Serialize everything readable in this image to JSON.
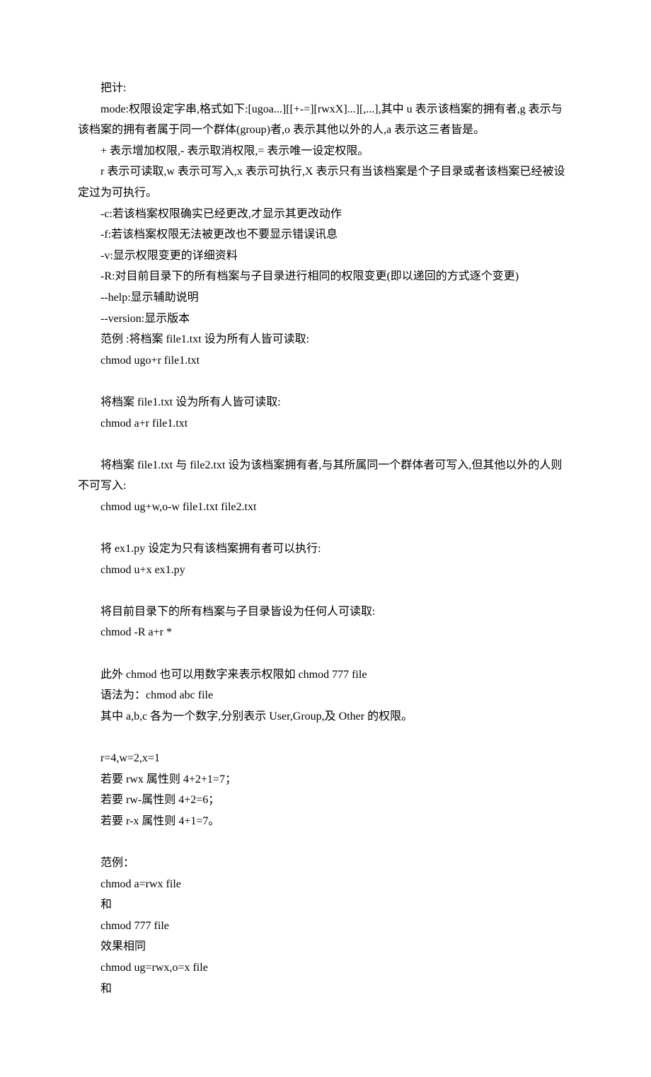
{
  "lines": [
    {
      "indent": true,
      "text": "把计:"
    },
    {
      "indent": true,
      "text": "mode:权限设定字串,格式如下:[ugoa...][[+-=][rwxX]...][,...],其中 u 表示该档案的拥有者,g 表示与该档案的拥有者属于同一个群体(group)者,o 表示其他以外的人,a 表示这三者皆是。",
      "wrap": true
    },
    {
      "indent": true,
      "text": "+ 表示增加权限,- 表示取消权限,= 表示唯一设定权限。"
    },
    {
      "indent": true,
      "text": "r 表示可读取,w 表示可写入,x 表示可执行,X 表示只有当该档案是个子目录或者该档案已经被设定过为可执行。",
      "wrap": true
    },
    {
      "indent": true,
      "text": "-c:若该档案权限确实已经更改,才显示其更改动作"
    },
    {
      "indent": true,
      "text": "-f:若该档案权限无法被更改也不要显示错误讯息"
    },
    {
      "indent": true,
      "text": "-v:显示权限变更的详细资料"
    },
    {
      "indent": true,
      "text": "-R:对目前目录下的所有档案与子目录进行相同的权限变更(即以递回的方式逐个变更)"
    },
    {
      "indent": true,
      "text": "--help:显示辅助说明"
    },
    {
      "indent": true,
      "text": "--version:显示版本"
    },
    {
      "indent": true,
      "text": "范例 :将档案 file1.txt 设为所有人皆可读取:"
    },
    {
      "indent": true,
      "text": "chmod ugo+r file1.txt"
    },
    {
      "blank": true
    },
    {
      "indent": true,
      "text": "将档案 file1.txt 设为所有人皆可读取:"
    },
    {
      "indent": true,
      "text": "chmod a+r file1.txt"
    },
    {
      "blank": true
    },
    {
      "indent": true,
      "text": "将档案 file1.txt 与 file2.txt 设为该档案拥有者,与其所属同一个群体者可写入,但其他以外的人则不可写入:",
      "wrap": true
    },
    {
      "indent": true,
      "text": "chmod ug+w,o-w file1.txt file2.txt"
    },
    {
      "blank": true
    },
    {
      "indent": true,
      "text": "将 ex1.py 设定为只有该档案拥有者可以执行:"
    },
    {
      "indent": true,
      "text": "chmod u+x ex1.py"
    },
    {
      "blank": true
    },
    {
      "indent": true,
      "text": "将目前目录下的所有档案与子目录皆设为任何人可读取:"
    },
    {
      "indent": true,
      "text": "chmod -R a+r *"
    },
    {
      "blank": true
    },
    {
      "indent": true,
      "text": "此外 chmod 也可以用数字来表示权限如 chmod 777 file"
    },
    {
      "indent": true,
      "text": "语法为：chmod abc file"
    },
    {
      "indent": true,
      "text": "其中 a,b,c 各为一个数字,分别表示 User,Group,及 Other 的权限。"
    },
    {
      "blank": true
    },
    {
      "indent": true,
      "text": "r=4,w=2,x=1"
    },
    {
      "indent": true,
      "text": "若要 rwx 属性则 4+2+1=7；"
    },
    {
      "indent": true,
      "text": "若要 rw-属性则 4+2=6；"
    },
    {
      "indent": true,
      "text": "若要 r-x 属性则 4+1=7。"
    },
    {
      "blank": true
    },
    {
      "indent": true,
      "text": "范例："
    },
    {
      "indent": true,
      "text": "chmod a=rwx file"
    },
    {
      "indent": true,
      "text": "和"
    },
    {
      "indent": true,
      "text": "chmod 777 file"
    },
    {
      "indent": true,
      "text": "效果相同"
    },
    {
      "indent": true,
      "text": "chmod ug=rwx,o=x file"
    },
    {
      "indent": true,
      "text": "和"
    }
  ]
}
